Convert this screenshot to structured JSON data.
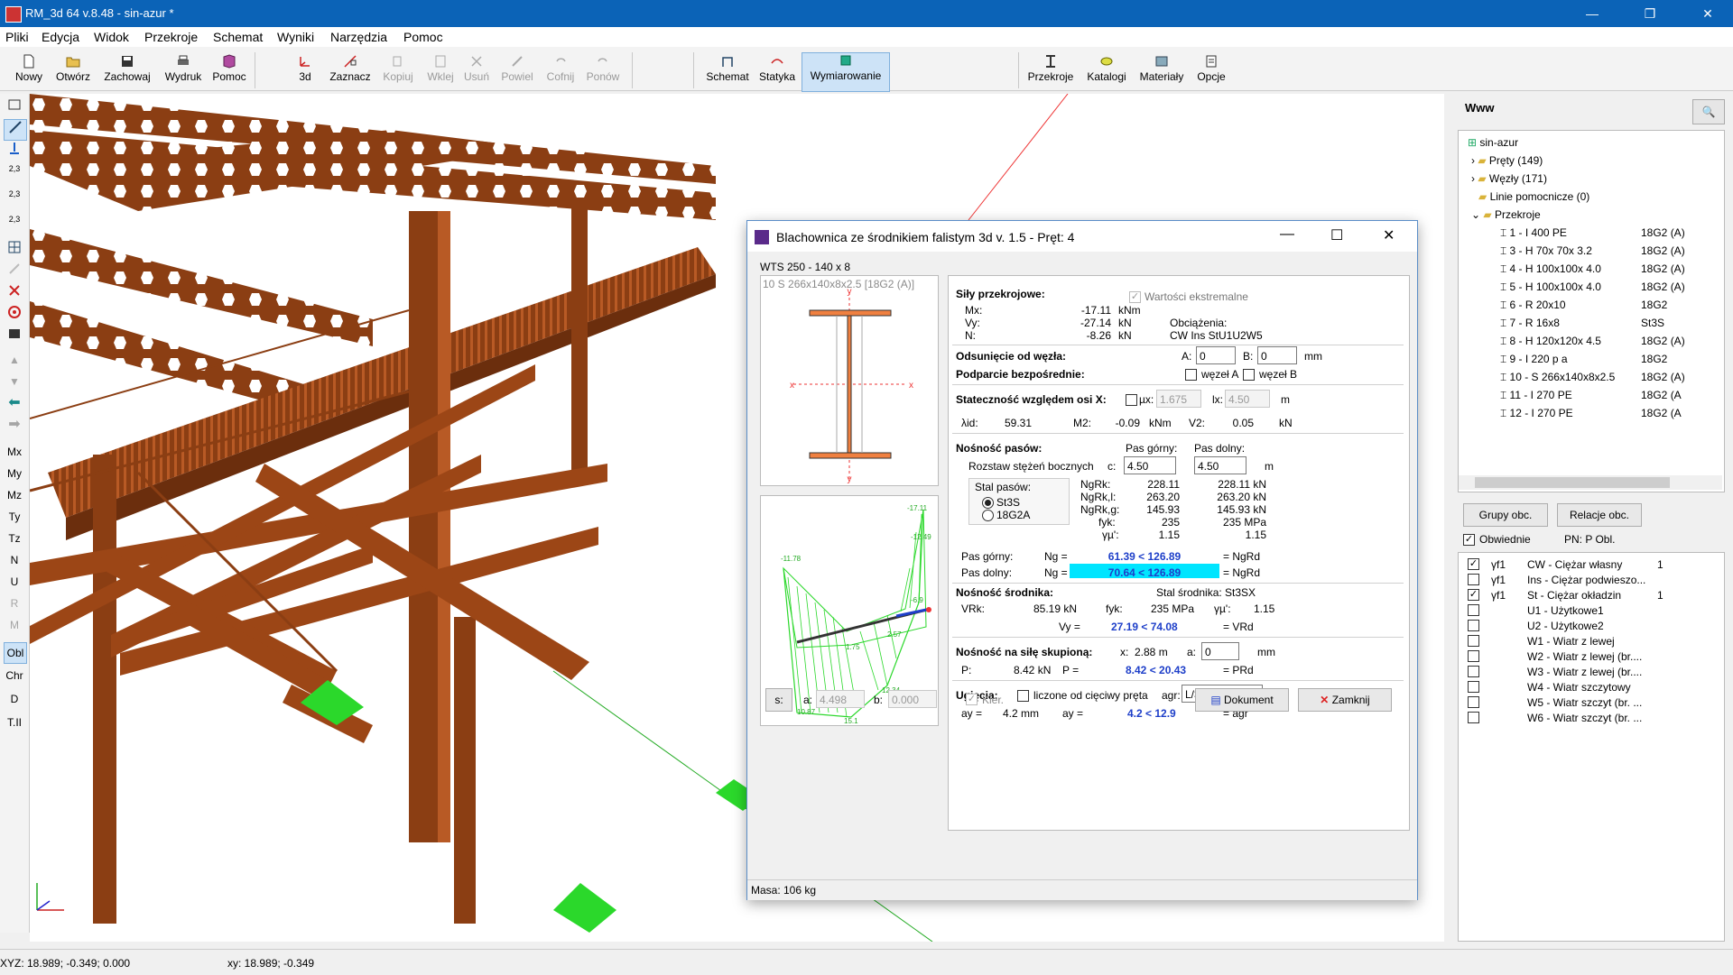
{
  "app": {
    "title": "RM_3d 64 v.8.48 - sin-azur *"
  },
  "window_buttons": {
    "minimize": "—",
    "maximize": "❐",
    "close": "✕"
  },
  "menu": [
    "Pliki",
    "Edycja",
    "Widok",
    "Przekroje",
    "Schemat",
    "Wyniki",
    "Narzędzia",
    "Pomoc"
  ],
  "toolbar": {
    "items": [
      "Nowy",
      "Otwórz",
      "Zachowaj",
      "Wydruk",
      "Pomoc",
      "3d",
      "Zaznacz",
      "Kopiuj",
      "Wklej",
      "Usuń",
      "Powiel",
      "Cofnij",
      "Ponów",
      "Schemat",
      "Statyka",
      "Wymiarowanie",
      "Przekroje",
      "Katalogi",
      "Materiały",
      "Opcje"
    ]
  },
  "left_toolbar": {
    "labels": [
      "Mx",
      "My",
      "Mz",
      "Ty",
      "Tz",
      "N",
      "U",
      "R",
      "M",
      "Obl",
      "Chr",
      "D",
      "T.II"
    ],
    "scale_labels": [
      "2,3",
      "2,3",
      "2,3"
    ]
  },
  "dialog": {
    "title": "Blachownica ze środnikiem falistym 3d v. 1.5 - Pręt: 4",
    "section_name": "WTS 250 - 140 x 8",
    "section_sub": "10 S 266x140x8x2.5  [18G2 (A)]",
    "axis_labels": {
      "y": "y",
      "x": "x"
    },
    "diagram_labels": [
      "-17.11",
      "-11.78",
      "-12.49",
      "15.1",
      "10.87",
      "12.34",
      "1.75",
      "2.57",
      "-6.9"
    ],
    "sily": {
      "title": "Siły przekrojowe:",
      "wartosci": "Wartości ekstremalne",
      "rows": [
        {
          "label": "Mx:",
          "value": "-17.11",
          "unit": "kNm"
        },
        {
          "label": "Vy:",
          "value": "-27.14",
          "unit": "kN"
        },
        {
          "label": "N:",
          "value": "-8.26",
          "unit": "kN"
        }
      ],
      "obciazenia_label": "Obciążenia:",
      "obciazenia_value": "CW Ins StU1U2W5"
    },
    "odsuniecie": {
      "title": "Odsunięcie od węzła:",
      "a_label": "A:",
      "a_value": "0",
      "b_label": "B:",
      "b_value": "0",
      "unit": "mm"
    },
    "podparcie": {
      "title": "Podparcie bezpośrednie:",
      "wezel_a": "węzeł A",
      "wezel_b": "węzeł B"
    },
    "statecznosc": {
      "title": "Stateczność względem osi X:",
      "mu_label": "µx:",
      "mu_value": "1.675",
      "lx_label": "lx:",
      "lx_value": "4.50",
      "unit": "m",
      "lambda_label": "λid:",
      "lambda_value": "59.31",
      "m2_label": "M2:",
      "m2_value": "-0.09",
      "m2_unit": "kNm",
      "v2_label": "V2:",
      "v2_value": "0.05",
      "v2_unit": "kN"
    },
    "nosnosc_pasow": {
      "title": "Nośność pasów:",
      "pas_gorny_header": "Pas górny:",
      "pas_dolny_header": "Pas dolny:",
      "rozstaw_label": "Rozstaw stężeń bocznych",
      "c_label": "c:",
      "c_gorny": "4.50",
      "c_dolny": "4.50",
      "c_unit": "m",
      "stal_label": "Stal pasów:",
      "radio1": "St3S",
      "radio2": "18G2A",
      "params": [
        {
          "label": "NgRk:",
          "g": "228.11",
          "d": "228.11 kN"
        },
        {
          "label": "NgRk,l:",
          "g": "263.20",
          "d": "263.20 kN"
        },
        {
          "label": "NgRk,g:",
          "g": "145.93",
          "d": "145.93 kN"
        },
        {
          "label": "fyk:",
          "g": "235",
          "d": "235 MPa"
        },
        {
          "label": "γµ':",
          "g": "1.15",
          "d": "1.15"
        }
      ],
      "gorny_label": "Pas górny:",
      "dolny_label": "Pas dolny:",
      "ng_label": "Ng =",
      "gorny_value": "61.39 < 126.89",
      "dolny_value": "70.64 < 126.89",
      "ngrd": "= NgRd"
    },
    "nosnosc_srodnika": {
      "title": "Nośność środnika:",
      "stal_label": "Stal środnika:",
      "stal_value": "St3SX",
      "vrk_label": "VRk:",
      "vrk_value": "85.19 kN",
      "fyk_label": "fyk:",
      "fyk_value": "235 MPa",
      "gamma_label": "γµ':",
      "gamma_value": "1.15",
      "vy_label": "Vy =",
      "vy_value": "27.19 < 74.08",
      "vrd": "= VRd"
    },
    "sila_skupiona": {
      "title": "Nośność na siłę skupioną:",
      "x_label": "x:",
      "x_value": "2.88 m",
      "a_label": "a:",
      "a_value": "0",
      "a_unit": "mm",
      "p_label": "P:",
      "p_value": "8.42 kN",
      "p_eq": "P =",
      "p_check": "8.42 < 20.43",
      "prd": "= PRd"
    },
    "ugiecia": {
      "title": "Ugięcia:",
      "cieciwy": "liczone od cięciwy pręta",
      "agr_label": "agr:",
      "agr_value": "L/350",
      "ay_label": "ay =",
      "ay_value": "4.2 mm",
      "ay_eq": "ay =",
      "ay_check": "4.2 < 12.9",
      "agr_eq": "= agr"
    },
    "bottom": {
      "s_button": "s:",
      "a_label": "a:",
      "a_value": "4.498",
      "b_label": "b:",
      "b_value": "0.000",
      "kier": "Kier.",
      "dokument": "Dokument",
      "zamknij": "Zamknij"
    },
    "status": "Masa: 106 kg"
  },
  "right_panel": {
    "header": "Www",
    "tree": [
      {
        "label": "sin-azur",
        "right": ""
      },
      {
        "label": "Pręty (149)",
        "right": ""
      },
      {
        "label": "Węzły (171)",
        "right": ""
      },
      {
        "label": "Linie pomocnicze (0)",
        "right": ""
      },
      {
        "label": "Przekroje",
        "right": ""
      },
      {
        "label": "1 - I 400 PE",
        "right": "18G2 (A)"
      },
      {
        "label": "3 - H 70x 70x 3.2",
        "right": "18G2 (A)"
      },
      {
        "label": "4 - H 100x100x 4.0",
        "right": "18G2 (A)"
      },
      {
        "label": "5 - H 100x100x 4.0",
        "right": "18G2 (A)"
      },
      {
        "label": "6 - R 20x10",
        "right": "18G2"
      },
      {
        "label": "7 - R 16x8",
        "right": "St3S"
      },
      {
        "label": "8 - H 120x120x 4.5",
        "right": "18G2 (A)"
      },
      {
        "label": "9 - I 220 p a",
        "right": "18G2"
      },
      {
        "label": "10 - S 266x140x8x2.5",
        "right": "18G2 (A)"
      },
      {
        "label": "11 - I 270 PE",
        "right": "18G2 (A"
      },
      {
        "label": "12 - I 270 PE",
        "right": "18G2 (A"
      }
    ],
    "grupy_button": "Grupy obc.",
    "relacje_button": "Relacje obc.",
    "obwiednie": "Obwiednie",
    "pn_label": "PN:  P Obl.",
    "load_cases": [
      {
        "checked": true,
        "code": "γf1",
        "name": "CW - Ciężar własny",
        "num": "1"
      },
      {
        "checked": false,
        "code": "γf1",
        "name": "Ins - Ciężar podwieszo...",
        "num": ""
      },
      {
        "checked": true,
        "code": "γf1",
        "name": "St - Ciężar okładzin",
        "num": "1"
      },
      {
        "checked": false,
        "code": "",
        "name": "U1 - Użytkowe1",
        "num": ""
      },
      {
        "checked": false,
        "code": "",
        "name": "U2 - Użytkowe2",
        "num": ""
      },
      {
        "checked": false,
        "code": "",
        "name": "W1 - Wiatr z lewej",
        "num": ""
      },
      {
        "checked": false,
        "code": "",
        "name": "W2 - Wiatr z lewej (br....",
        "num": ""
      },
      {
        "checked": false,
        "code": "",
        "name": "W3 - Wiatr z lewej (br....",
        "num": ""
      },
      {
        "checked": false,
        "code": "",
        "name": "W4 - Wiatr szczytowy",
        "num": ""
      },
      {
        "checked": false,
        "code": "",
        "name": "W5 - Wiatr szczyt (br. ...",
        "num": ""
      },
      {
        "checked": false,
        "code": "",
        "name": "W6 - Wiatr szczyt (br. ...",
        "num": ""
      }
    ]
  },
  "statusbar": {
    "xyz": "XYZ: 18.989; -0.349; 0.000",
    "xy": "xy: 18.989; -0.349"
  },
  "colors": {
    "title_bg": "#0b63b7",
    "steel": "#8b3e13",
    "steel_light": "#b85a25",
    "support": "#2bd82b",
    "highlight": "#00e5ff",
    "value_blue": "#1e3fc9"
  }
}
